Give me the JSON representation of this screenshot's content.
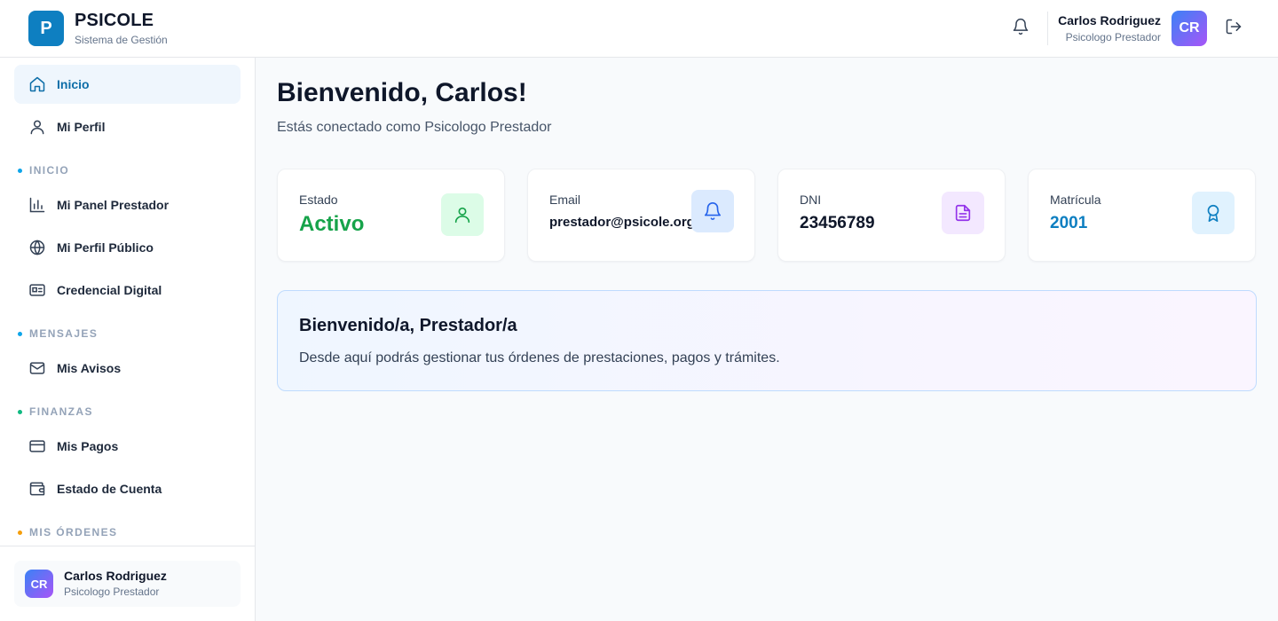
{
  "app": {
    "logo_letter": "P",
    "name": "PSICOLE",
    "subtitle": "Sistema de Gestión"
  },
  "header": {
    "user_name": "Carlos Rodriguez",
    "user_role": "Psicologo Prestador",
    "avatar_initials": "CR",
    "icons": [
      "bell-icon",
      "logout-icon"
    ]
  },
  "sidebar": {
    "top_items": [
      {
        "label": "Inicio",
        "icon": "home-icon",
        "active": true
      },
      {
        "label": "Mi Perfil",
        "icon": "user-icon",
        "active": false
      }
    ],
    "sections": [
      {
        "title": "INICIO",
        "dot_color": "#0ea5e9",
        "items": [
          {
            "label": "Mi Panel Prestador",
            "icon": "bar-chart-icon"
          },
          {
            "label": "Mi Perfil Público",
            "icon": "globe-icon"
          },
          {
            "label": "Credencial Digital",
            "icon": "id-card-icon"
          }
        ]
      },
      {
        "title": "MENSAJES",
        "dot_color": "#0ea5e9",
        "items": [
          {
            "label": "Mis Avisos",
            "icon": "mail-icon"
          }
        ]
      },
      {
        "title": "FINANZAS",
        "dot_color": "#10b981",
        "items": [
          {
            "label": "Mis Pagos",
            "icon": "credit-card-icon"
          },
          {
            "label": "Estado de Cuenta",
            "icon": "wallet-icon"
          }
        ]
      },
      {
        "title": "MIS ÓRDENES",
        "dot_color": "#f59e0b",
        "items": []
      }
    ],
    "footer_user": {
      "initials": "CR",
      "name": "Carlos Rodriguez",
      "role": "Psicologo Prestador"
    }
  },
  "main": {
    "welcome_title": "Bienvenido, Carlos!",
    "welcome_subtitle": "Estás conectado como Psicologo Prestador",
    "cards": [
      {
        "label": "Estado",
        "value": "Activo",
        "value_color": "#16a34a",
        "icon": "user-icon",
        "icon_bg": "#dcfce7",
        "icon_color": "#16a34a"
      },
      {
        "label": "Email",
        "value": "prestador@psicole.org",
        "value_color": "#0f172a",
        "icon": "bell-icon",
        "icon_bg": "#dbeafe",
        "icon_color": "#2563eb"
      },
      {
        "label": "DNI",
        "value": "23456789",
        "value_color": "#0f172a",
        "icon": "document-icon",
        "icon_bg": "#f3e8ff",
        "icon_color": "#9333ea"
      },
      {
        "label": "Matrícula",
        "value": "2001",
        "value_color": "#0e7fc1",
        "icon": "award-icon",
        "icon_bg": "#e0f2fe",
        "icon_color": "#0e7fc1"
      }
    ],
    "banner": {
      "title": "Bienvenido/a, Prestador/a",
      "text": "Desde aquí podrás gestionar tus órdenes de prestaciones, pagos y trámites."
    }
  }
}
